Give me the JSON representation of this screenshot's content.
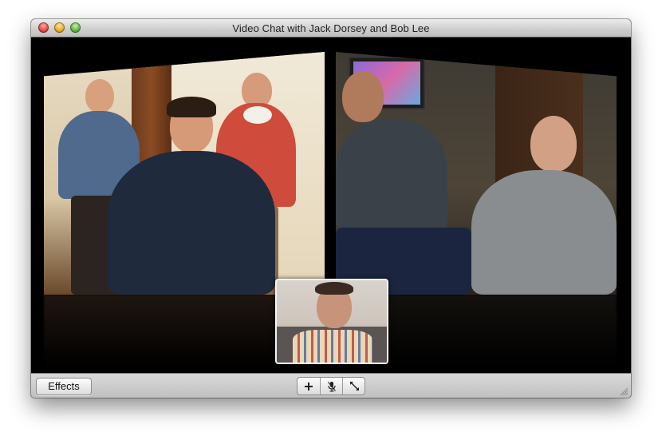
{
  "window": {
    "title": "Video Chat with Jack Dorsey and Bob Lee"
  },
  "toolbar": {
    "effects_label": "Effects"
  },
  "icons": {
    "close": "close-icon",
    "minimize": "minimize-icon",
    "zoom": "zoom-icon",
    "add": "plus-icon",
    "mute": "microphone-icon",
    "fullscreen": "fullscreen-icon",
    "resize": "resize-grip-icon"
  },
  "colors": {
    "close": "#e0443a",
    "minimize": "#e6a823",
    "zoom": "#5bb43c"
  }
}
